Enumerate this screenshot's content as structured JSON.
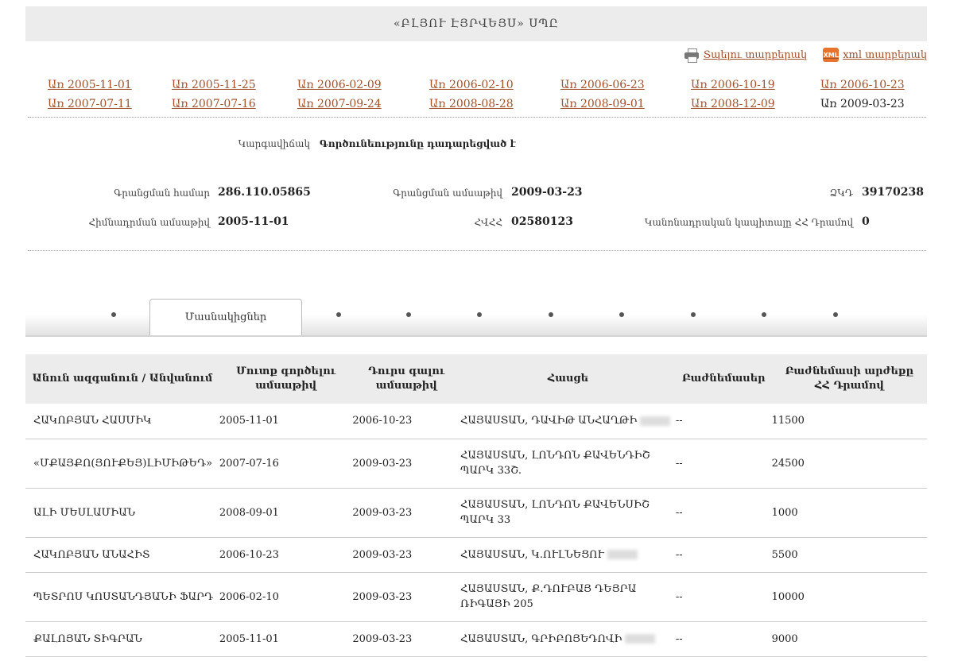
{
  "header": {
    "title": "«ԲԼՅՈՒ ԷՅՐՎԵՅՍ» ՍՊԸ"
  },
  "downloads": {
    "print_label": "Տպելու տարբերակ",
    "xml_label": "xml տարբերակ",
    "xml_icon_text": "XML"
  },
  "versions": [
    "Առ 2005-11-01",
    "Առ 2005-11-25",
    "Առ 2006-02-09",
    "Առ 2006-02-10",
    "Առ 2006-06-23",
    "Առ 2006-10-19",
    "Առ 2006-10-23",
    "Առ 2007-07-11",
    "Առ 2007-07-16",
    "Առ 2007-09-24",
    "Առ 2008-08-28",
    "Առ 2008-09-01",
    "Առ 2008-12-09",
    "Առ 2009-03-23"
  ],
  "current_version": "Առ 2009-03-23",
  "status": {
    "label": "Կարգավիճակ",
    "value": "Գործունեությունը դադարեցված է"
  },
  "info": {
    "reg_number_label": "Գրանցման համար",
    "reg_number": "286.110.05865",
    "reg_date_label": "Գրանցման ամսաթիվ",
    "reg_date": "2009-03-23",
    "code_label": "ՁԿԴ",
    "code": "39170238",
    "founded_label": "Հիմնադրման ամսաթիվ",
    "founded": "2005-11-01",
    "tin_label": "ՀՎՀՀ",
    "tin": "02580123",
    "capital_label": "Կանոնադրական կապիտալը ՀՀ Դրամով",
    "capital": "0"
  },
  "tabs": {
    "active_label": "Մասնակիցներ"
  },
  "table": {
    "headers": [
      "Անուն ազգանուն / Անվանում",
      "Մուտք գործելու ամսաթիվ",
      "Դուրս գալու ամսաթիվ",
      "Հասցե",
      "Բաժնեմասեր",
      "Բաժնեմասի արժեքը ՀՀ Դրամով"
    ],
    "rows": [
      [
        "ՀԱԿՈԲՅԱՆ ՀԱՍՄԻԿ",
        "2005-11-01",
        "2006-10-23",
        "ՀԱՅԱՍՏԱՆ, ԴԱՎԻԹ ԱՆՀԱՂԹԻ",
        "--",
        "11500"
      ],
      [
        "«ՄՔԱՅՔՈ(ՅՈՒՔԵՅ)ԼԻՄԻԹԵԴ»",
        "2007-07-16",
        "2009-03-23",
        "ՀԱՅԱՍՏԱՆ, ԼՈՆԴՈՆ ՔԱՎԵՆԴԻՇ ՊԱՐԿ 33Շ.",
        "--",
        "24500"
      ],
      [
        "ԱԼԻ ՄԵՍԼԱՄԻԱՆ",
        "2008-09-01",
        "2009-03-23",
        "ՀԱՅԱՍՏԱՆ, ԼՈՆԴՈՆ ՔԱՎԵՆՍԻՇ ՊԱՐԿ 33",
        "--",
        "1000"
      ],
      [
        "ՀԱԿՈԲՅԱՆ ԱՆԱՀԻՏ",
        "2006-10-23",
        "2009-03-23",
        "ՀԱՅԱՍՏԱՆ, Կ.ՈՒԼՆԵՑՈՒ",
        "--",
        "5500"
      ],
      [
        "ՊԵՏՐՈՍ ԿՈՍՏԱՆԴՅԱՆԻ ՖԱՐԴ",
        "2006-02-10",
        "2009-03-23",
        "ՀԱՅԱՍՏԱՆ, Ք.ԴՈՒԲԱՅ ԴԵՅՐԱ ՌԻԳԱՅԻ 205",
        "--",
        "10000"
      ],
      [
        "ՔԱԼՈՅԱՆ ՏԻԳՐԱՆ",
        "2005-11-01",
        "2009-03-23",
        "ՀԱՅԱՍՏԱՆ, ԳՐԻԲՈՅԵԴՈՎԻ",
        "--",
        "9000"
      ]
    ]
  }
}
